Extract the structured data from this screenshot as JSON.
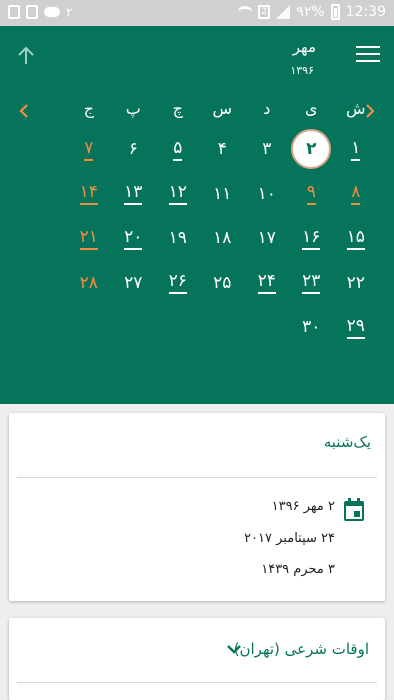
{
  "status_bar": {
    "notification_count": "۲",
    "battery_percent": "۹۲%",
    "time": "12:39",
    "sim_label": "2"
  },
  "header": {
    "month": "مهر",
    "year": "۱۳۹۶"
  },
  "weekdays": [
    "ش",
    "ی",
    "د",
    "س",
    "چ",
    "پ",
    "ج"
  ],
  "weeks": [
    [
      {
        "day": "۱",
        "event": true
      },
      {
        "day": "۲",
        "selected": true
      },
      {
        "day": "۳"
      },
      {
        "day": "۴"
      },
      {
        "day": "۵",
        "event": true
      },
      {
        "day": "۶"
      },
      {
        "day": "۷",
        "holiday": true,
        "event": true
      }
    ],
    [
      {
        "day": "۸",
        "holiday": true,
        "event": true
      },
      {
        "day": "۹",
        "holiday": true,
        "event": true
      },
      {
        "day": "۱۰"
      },
      {
        "day": "۱۱"
      },
      {
        "day": "۱۲",
        "event": true
      },
      {
        "day": "۱۳",
        "event": true
      },
      {
        "day": "۱۴",
        "holiday": true,
        "event": true
      }
    ],
    [
      {
        "day": "۱۵",
        "event": true
      },
      {
        "day": "۱۶",
        "event": true
      },
      {
        "day": "۱۷"
      },
      {
        "day": "۱۸"
      },
      {
        "day": "۱۹"
      },
      {
        "day": "۲۰",
        "event": true
      },
      {
        "day": "۲۱",
        "holiday": true,
        "event": true
      }
    ],
    [
      {
        "day": "۲۲"
      },
      {
        "day": "۲۳",
        "event": true
      },
      {
        "day": "۲۴",
        "event": true
      },
      {
        "day": "۲۵"
      },
      {
        "day": "۲۶",
        "event": true
      },
      {
        "day": "۲۷"
      },
      {
        "day": "۲۸",
        "holiday": true
      }
    ],
    [
      {
        "day": "۲۹",
        "event": true
      },
      {
        "day": "۳۰"
      }
    ]
  ],
  "day_card": {
    "day_name": "یک‌شنبه",
    "persian_date": "۲ مهر ۱۳۹۶",
    "gregorian_date": "۲۴ سپتامبر ۲۰۱۷",
    "hijri_date": "۳ محرم ۱۴۳۹"
  },
  "owqat_card": {
    "title": "اوقات شرعی (تهران)"
  },
  "colors": {
    "primary": "#06745b",
    "holiday": "#f08d45",
    "background": "#eeeeee"
  }
}
